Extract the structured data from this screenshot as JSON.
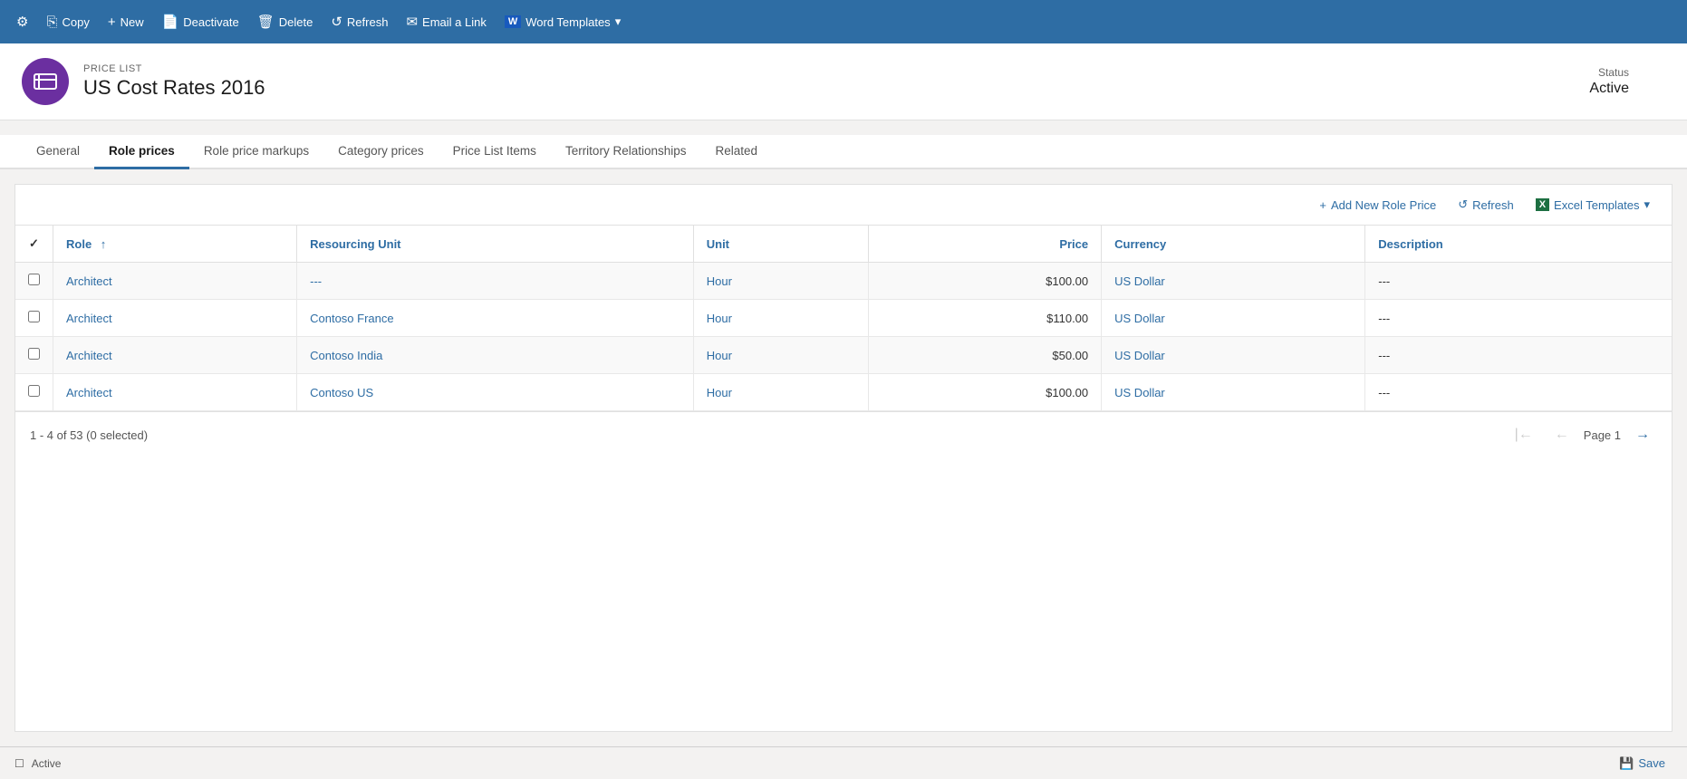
{
  "toolbar": {
    "buttons": [
      {
        "id": "copy",
        "icon": "⚙",
        "label": "Copy"
      },
      {
        "id": "new",
        "icon": "+",
        "label": "New"
      },
      {
        "id": "deactivate",
        "icon": "📄",
        "label": "Deactivate"
      },
      {
        "id": "delete",
        "icon": "🗑",
        "label": "Delete"
      },
      {
        "id": "refresh",
        "icon": "↺",
        "label": "Refresh"
      },
      {
        "id": "email",
        "icon": "✉",
        "label": "Email a Link"
      },
      {
        "id": "word",
        "icon": "W",
        "label": "Word Templates"
      }
    ]
  },
  "header": {
    "label": "PRICE LIST",
    "title": "US Cost Rates 2016",
    "status_label": "Status",
    "status_value": "Active"
  },
  "tabs": [
    {
      "id": "general",
      "label": "General",
      "active": false
    },
    {
      "id": "role-prices",
      "label": "Role prices",
      "active": true
    },
    {
      "id": "role-price-markups",
      "label": "Role price markups",
      "active": false
    },
    {
      "id": "category-prices",
      "label": "Category prices",
      "active": false
    },
    {
      "id": "price-list-items",
      "label": "Price List Items",
      "active": false
    },
    {
      "id": "territory-relationships",
      "label": "Territory Relationships",
      "active": false
    },
    {
      "id": "related",
      "label": "Related",
      "active": false
    }
  ],
  "subtoolbar": {
    "add_label": "Add New Role Price",
    "refresh_label": "Refresh",
    "excel_label": "Excel Templates"
  },
  "table": {
    "columns": [
      {
        "id": "check",
        "label": ""
      },
      {
        "id": "role",
        "label": "Role"
      },
      {
        "id": "resourcing-unit",
        "label": "Resourcing Unit"
      },
      {
        "id": "unit",
        "label": "Unit"
      },
      {
        "id": "price",
        "label": "Price"
      },
      {
        "id": "currency",
        "label": "Currency"
      },
      {
        "id": "description",
        "label": "Description"
      }
    ],
    "rows": [
      {
        "role": "Architect",
        "resourcing_unit": "---",
        "unit": "Hour",
        "price": "$100.00",
        "currency": "US Dollar",
        "description": "---"
      },
      {
        "role": "Architect",
        "resourcing_unit": "Contoso France",
        "unit": "Hour",
        "price": "$110.00",
        "currency": "US Dollar",
        "description": "---"
      },
      {
        "role": "Architect",
        "resourcing_unit": "Contoso India",
        "unit": "Hour",
        "price": "$50.00",
        "currency": "US Dollar",
        "description": "---"
      },
      {
        "role": "Architect",
        "resourcing_unit": "Contoso US",
        "unit": "Hour",
        "price": "$100.00",
        "currency": "US Dollar",
        "description": "---"
      }
    ]
  },
  "pagination": {
    "summary": "1 - 4 of 53 (0 selected)",
    "page_label": "Page 1"
  },
  "status_bar": {
    "status": "Active",
    "save_label": "Save"
  }
}
